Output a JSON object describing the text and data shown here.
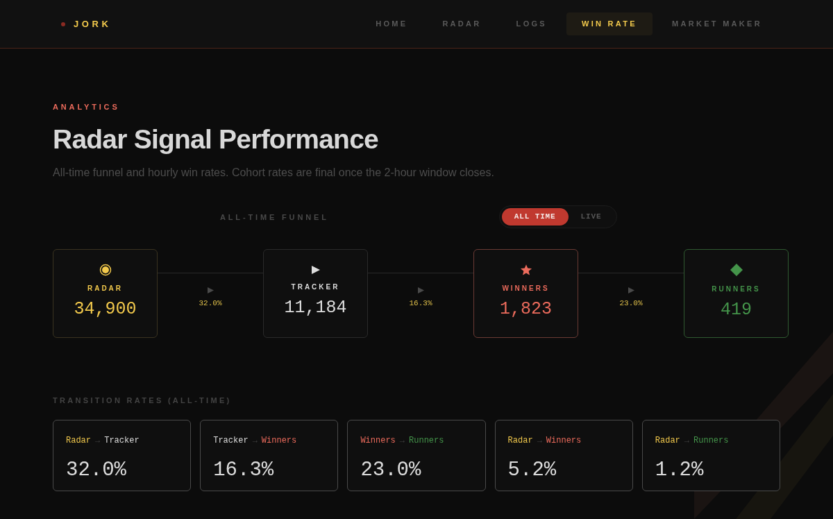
{
  "brand": {
    "name": "JORK"
  },
  "nav": [
    {
      "label": "HOME",
      "selected": false
    },
    {
      "label": "RADAR",
      "selected": false
    },
    {
      "label": "LOGS",
      "selected": false
    },
    {
      "label": "WIN RATE",
      "selected": true
    },
    {
      "label": "MARKET MAKER",
      "selected": false
    }
  ],
  "eyebrow": "ANALYTICS",
  "title": "Radar Signal Performance",
  "subtitle": "All-time funnel and hourly win rates. Cohort rates are final once the 2-hour window closes.",
  "funnel": {
    "heading": "ALL-TIME FUNNEL",
    "toggle": [
      {
        "label": "ALL TIME",
        "selected": true
      },
      {
        "label": "LIVE",
        "selected": false
      }
    ],
    "stages": [
      {
        "kind": "radar",
        "label": "RADAR",
        "value": "34,900"
      },
      {
        "kind": "tracker",
        "label": "TRACKER",
        "value": "11,184"
      },
      {
        "kind": "winners",
        "label": "WINNERS",
        "value": "1,823"
      },
      {
        "kind": "runners",
        "label": "RUNNERS",
        "value": "419"
      }
    ],
    "steps": [
      "32.0%",
      "16.3%",
      "23.0%"
    ]
  },
  "transitions": {
    "heading": "TRANSITION RATES (ALL-TIME)",
    "cards": [
      {
        "from": {
          "kind": "radar",
          "label": "Radar"
        },
        "arrow": "→",
        "to": {
          "kind": "tracker",
          "label": "Tracker"
        },
        "value": "32.0%"
      },
      {
        "from": {
          "kind": "tracker",
          "label": "Tracker"
        },
        "arrow": "→",
        "to": {
          "kind": "winners",
          "label": "Winners"
        },
        "value": "16.3%"
      },
      {
        "from": {
          "kind": "winners",
          "label": "Winners"
        },
        "arrow": "→",
        "to": {
          "kind": "runners",
          "label": "Runners"
        },
        "value": "23.0%"
      },
      {
        "from": {
          "kind": "radar",
          "label": "Radar"
        },
        "arrow": "→",
        "to": {
          "kind": "winners",
          "label": "Winners"
        },
        "value": "5.2%"
      },
      {
        "from": {
          "kind": "radar",
          "label": "Radar"
        },
        "arrow": "→",
        "to": {
          "kind": "runners",
          "label": "Runners"
        },
        "value": "1.2%"
      }
    ]
  }
}
